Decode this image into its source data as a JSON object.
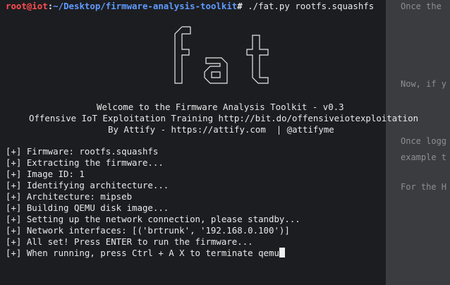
{
  "prompt": {
    "user_host": "root@iot",
    "sep": ":",
    "path": "~/Desktop/firmware-analysis-toolkit",
    "symbol": "#",
    "command": " ./fat.py rootfs.squashfs"
  },
  "banner": {
    "logo_text": "fat",
    "welcome": "Welcome to the Firmware Analysis Toolkit - v0.3",
    "training": "Offensive IoT Exploitation Training http://bit.do/offensiveiotexploitation",
    "byline": "By Attify - https://attify.com  | @attifyme"
  },
  "output_lines": [
    "[+] Firmware: rootfs.squashfs",
    "[+] Extracting the firmware...",
    "[+] Image ID: 1",
    "[+] Identifying architecture...",
    "[+] Architecture: mipseb",
    "[+] Building QEMU disk image...",
    "[+] Setting up the network connection, please standby...",
    "[+] Network interfaces: [('brtrunk', '192.168.0.100')]",
    "[+] All set! Press ENTER to run the firmware...",
    "[+] When running, press Ctrl + A X to terminate qemu"
  ],
  "background_doc": {
    "lines": [
      "Once the",
      "Now, if y",
      "Once logg",
      "example t",
      "For the H"
    ]
  },
  "colors": {
    "terminal_bg": "#1c1d21",
    "user_host": "#ff4d4d",
    "path": "#5f9bff",
    "text": "#e8e8e8"
  }
}
